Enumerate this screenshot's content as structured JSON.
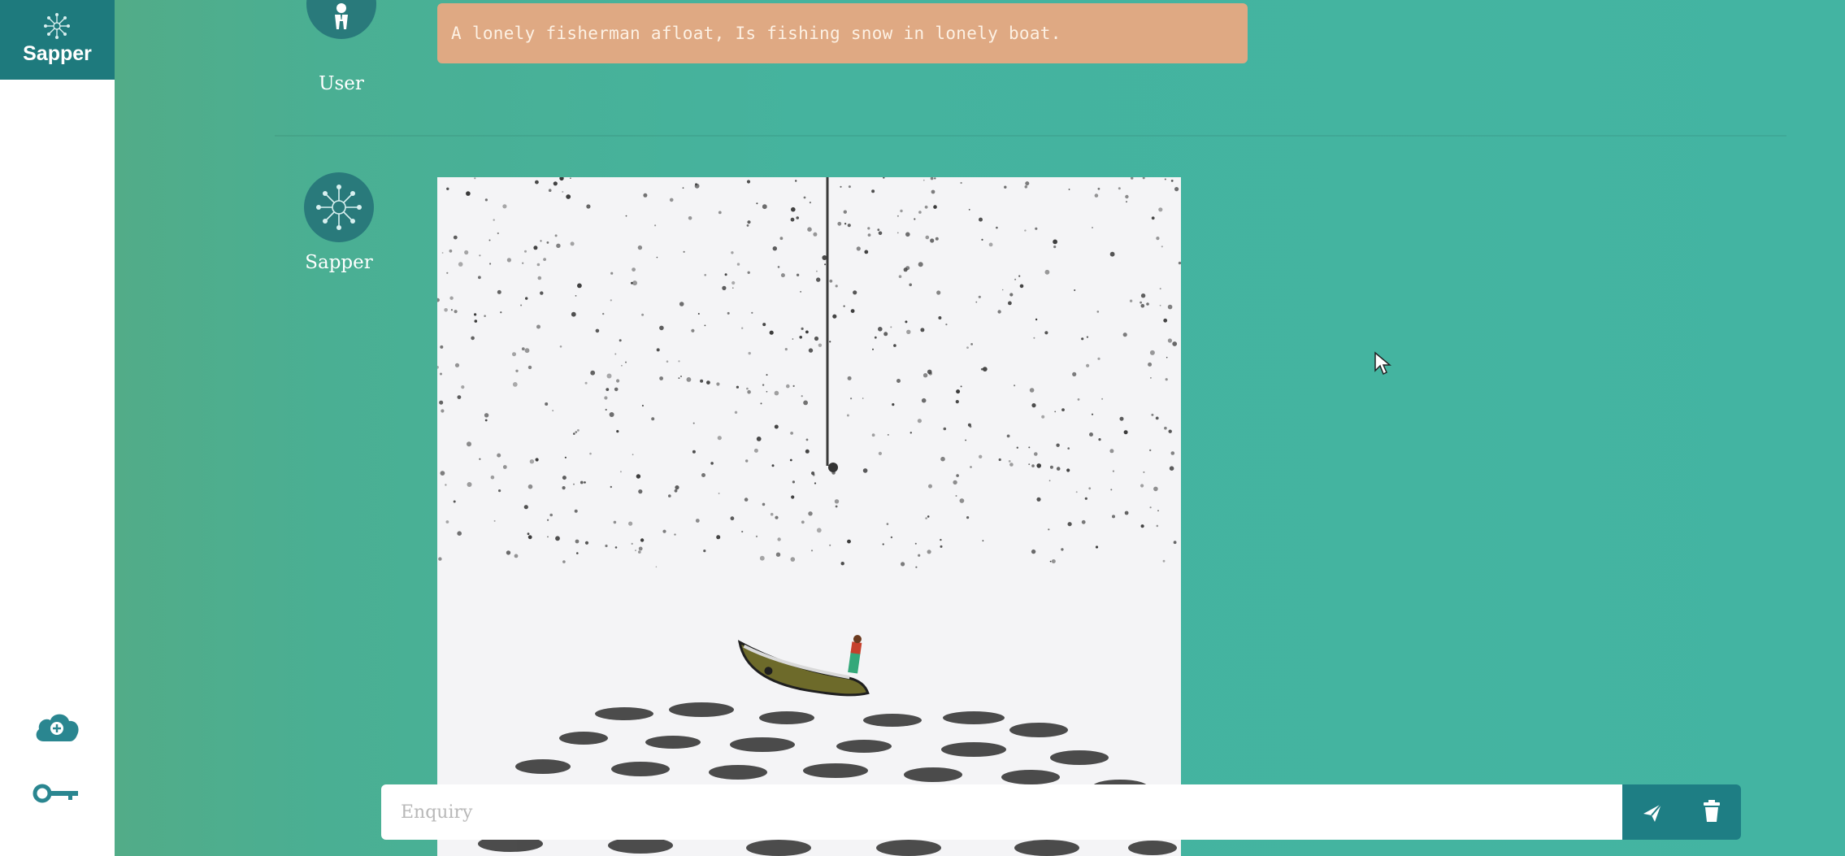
{
  "sidebar": {
    "brand_name": "Sapper",
    "icons": [
      "cloud-upload-icon",
      "key-icon"
    ]
  },
  "conversation": {
    "user": {
      "name": "User",
      "message": "A lonely fisherman afloat, Is fishing snow in lonely boat."
    },
    "assistant": {
      "name": "Sapper",
      "image_alt": "fisherman in boat amid falling snow"
    }
  },
  "input": {
    "placeholder": "Enquiry",
    "value": ""
  },
  "actions": {
    "send_icon": "send-icon",
    "delete_icon": "trash-icon"
  },
  "colors": {
    "brand": "#1e7a7d",
    "background": "#44b39f",
    "user_bubble": "#dfa983",
    "avatar": "#297a7b"
  }
}
